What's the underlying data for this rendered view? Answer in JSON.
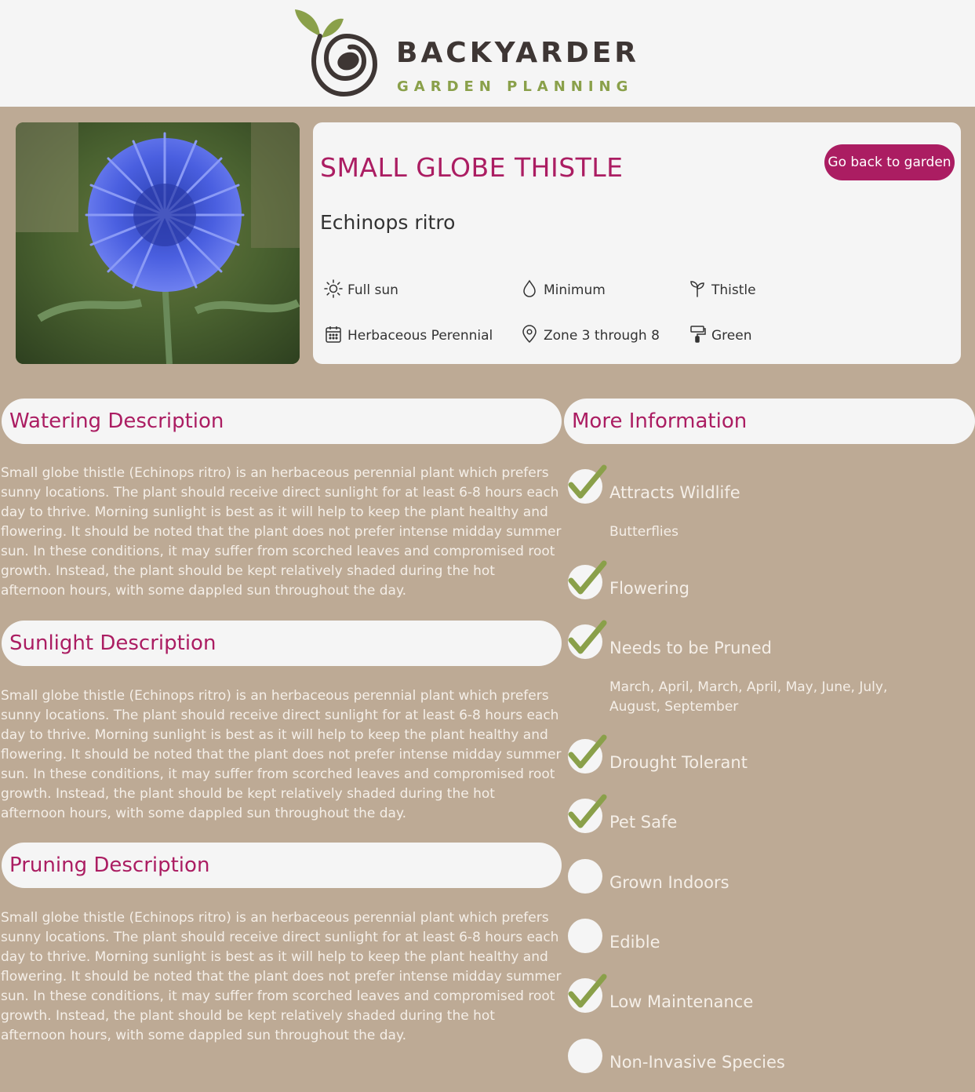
{
  "header": {
    "brand": "BACKYARDER",
    "tagline": "GARDEN PLANNING"
  },
  "plant": {
    "common_name": "SMALL GLOBE THISTLE",
    "scientific_name": "Echinops ritro",
    "back_button": "Go back to garden",
    "attributes": {
      "sunlight": "Full sun",
      "watering": "Minimum",
      "type": "Thistle",
      "cycle": "Herbaceous Perennial",
      "hardiness": "Zone 3 through 8",
      "color": "Green"
    }
  },
  "sections": {
    "watering": {
      "title": "Watering Description",
      "text": "Small globe thistle (Echinops ritro) is an herbaceous perennial plant which prefers sunny locations. The plant should receive direct sunlight for at least 6-8 hours each day to thrive. Morning sunlight is best as it will help to keep the plant healthy and flowering. It should be noted that the plant does not prefer intense midday summer sun. In these conditions, it may suffer from scorched leaves and compromised root growth. Instead, the plant should be kept relatively shaded during the hot afternoon hours, with some dappled sun throughout the day."
    },
    "sunlight": {
      "title": "Sunlight Description",
      "text": "Small globe thistle (Echinops ritro) is an herbaceous perennial plant which prefers sunny locations. The plant should receive direct sunlight for at least 6-8 hours each day to thrive. Morning sunlight is best as it will help to keep the plant healthy and flowering. It should be noted that the plant does not prefer intense midday summer sun. In these conditions, it may suffer from scorched leaves and compromised root growth. Instead, the plant should be kept relatively shaded during the hot afternoon hours, with some dappled sun throughout the day."
    },
    "pruning": {
      "title": "Pruning Description",
      "text": "Small globe thistle (Echinops ritro) is an herbaceous perennial plant which prefers sunny locations. The plant should receive direct sunlight for at least 6-8 hours each day to thrive. Morning sunlight is best as it will help to keep the plant healthy and flowering. It should be noted that the plant does not prefer intense midday summer sun. In these conditions, it may suffer from scorched leaves and compromised root growth. Instead, the plant should be kept relatively shaded during the hot afternoon hours, with some dappled sun throughout the day."
    }
  },
  "more_info": {
    "title": "More Information",
    "items": [
      {
        "label": "Attracts Wildlife",
        "checked": true,
        "detail": "Butterflies"
      },
      {
        "label": "Flowering",
        "checked": true
      },
      {
        "label": "Needs to be Pruned",
        "checked": true,
        "detail": "March, April, March, April, May, June, July, August, September"
      },
      {
        "label": "Drought Tolerant",
        "checked": true
      },
      {
        "label": "Pet Safe",
        "checked": true
      },
      {
        "label": "Grown Indoors",
        "checked": false
      },
      {
        "label": "Edible",
        "checked": false
      },
      {
        "label": "Low Maintenance",
        "checked": true
      },
      {
        "label": "Non-Invasive Species",
        "checked": false
      }
    ]
  },
  "colors": {
    "accent": "#ab1d62",
    "background": "#bdaa95",
    "card": "#f5f5f5",
    "check": "#8aa04a",
    "brand_dark": "#3e3634"
  },
  "icons": {
    "sunlight": "sun-icon",
    "watering": "water-drop-icon",
    "type": "sprout-icon",
    "cycle": "calendar-icon",
    "hardiness": "map-pin-icon",
    "color": "paint-roller-icon",
    "check": "checkmark-icon"
  }
}
